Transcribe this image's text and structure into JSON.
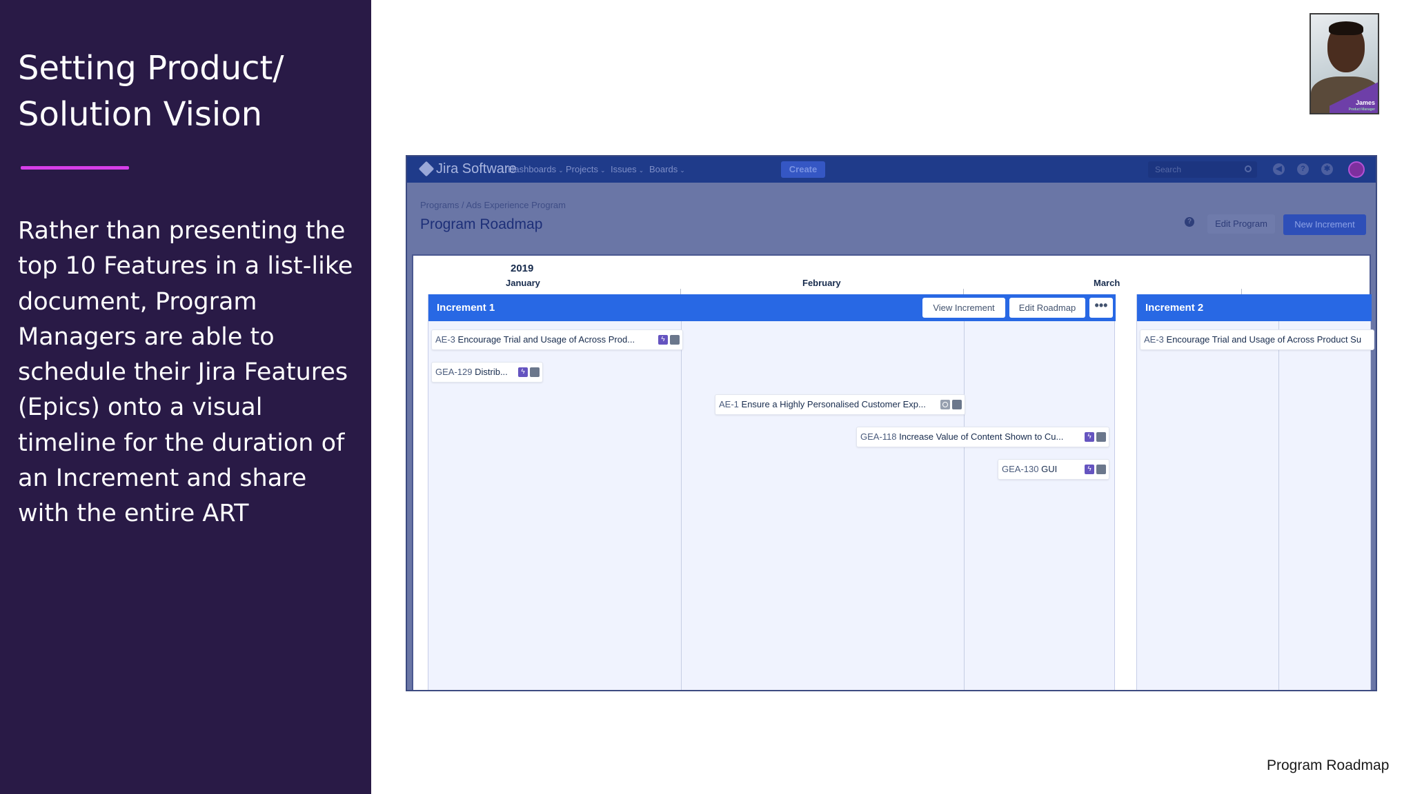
{
  "slide": {
    "title": "Setting Product/ Solution Vision",
    "body": "Rather than presenting the top 10 Features in a list-like document, Program Managers are able to schedule their Jira Features (Epics) onto a visual timeline for the duration of an Increment and share with the entire ART",
    "caption": "Program Roadmap",
    "accent_color": "#d63ee8",
    "panel_color": "#291a46"
  },
  "webcam": {
    "name": "James",
    "role": "Product Manager"
  },
  "jira": {
    "logo": "Jira Software",
    "nav": [
      "Dashboards",
      "Projects",
      "Issues",
      "Boards"
    ],
    "create_label": "Create",
    "search_placeholder": "Search",
    "breadcrumb": "Programs  / Ads Experience Program",
    "page_title": "Program Roadmap",
    "edit_program_label": "Edit Program",
    "new_increment_label": "New Increment",
    "timeline": {
      "year": "2019",
      "months": [
        "January",
        "February",
        "March"
      ]
    },
    "increments": [
      {
        "title": "Increment 1",
        "view_label": "View Increment",
        "edit_label": "Edit Roadmap",
        "more_label": "•••",
        "features": [
          {
            "key": "AE-3",
            "title": "Encourage Trial and Usage of Across Prod...",
            "icon": "bolt-icon"
          },
          {
            "key": "GEA-129",
            "title": "Distrib...",
            "icon": "bolt-icon"
          },
          {
            "key": "AE-1",
            "title": "Ensure a Highly Personalised Customer Exp...",
            "icon": "circle-icon"
          },
          {
            "key": "GEA-118",
            "title": "Increase Value of Content Shown to Cu...",
            "icon": "bolt-icon"
          },
          {
            "key": "GEA-130",
            "title": "GUI",
            "icon": "bolt-icon"
          }
        ]
      },
      {
        "title": "Increment 2",
        "features": [
          {
            "key": "AE-3",
            "title": "Encourage Trial and Usage of Across Product Su",
            "icon": "bolt-icon"
          }
        ]
      }
    ]
  }
}
